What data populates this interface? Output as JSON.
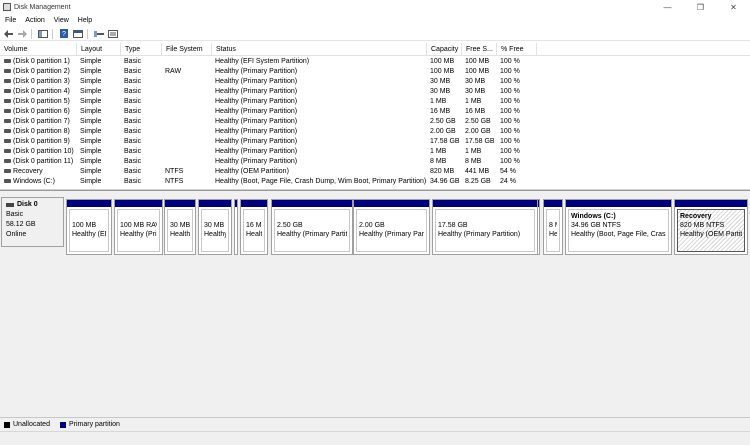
{
  "window": {
    "title": "Disk Management",
    "minimize": "—",
    "restore": "❐",
    "close": "✕"
  },
  "menu": [
    "File",
    "Action",
    "View",
    "Help"
  ],
  "columns": [
    "Volume",
    "Layout",
    "Type",
    "File System",
    "Status",
    "Capacity",
    "Free S...",
    "% Free"
  ],
  "volumes": [
    {
      "volume": "(Disk 0 partition 1)",
      "layout": "Simple",
      "type": "Basic",
      "fs": "",
      "status": "Healthy (EFI System Partition)",
      "capacity": "100 MB",
      "free": "100 MB",
      "pct": "100 %"
    },
    {
      "volume": "(Disk 0 partition 2)",
      "layout": "Simple",
      "type": "Basic",
      "fs": "RAW",
      "status": "Healthy (Primary Partition)",
      "capacity": "100 MB",
      "free": "100 MB",
      "pct": "100 %"
    },
    {
      "volume": "(Disk 0 partition 3)",
      "layout": "Simple",
      "type": "Basic",
      "fs": "",
      "status": "Healthy (Primary Partition)",
      "capacity": "30 MB",
      "free": "30 MB",
      "pct": "100 %"
    },
    {
      "volume": "(Disk 0 partition 4)",
      "layout": "Simple",
      "type": "Basic",
      "fs": "",
      "status": "Healthy (Primary Partition)",
      "capacity": "30 MB",
      "free": "30 MB",
      "pct": "100 %"
    },
    {
      "volume": "(Disk 0 partition 5)",
      "layout": "Simple",
      "type": "Basic",
      "fs": "",
      "status": "Healthy (Primary Partition)",
      "capacity": "1 MB",
      "free": "1 MB",
      "pct": "100 %"
    },
    {
      "volume": "(Disk 0 partition 6)",
      "layout": "Simple",
      "type": "Basic",
      "fs": "",
      "status": "Healthy (Primary Partition)",
      "capacity": "16 MB",
      "free": "16 MB",
      "pct": "100 %"
    },
    {
      "volume": "(Disk 0 partition 7)",
      "layout": "Simple",
      "type": "Basic",
      "fs": "",
      "status": "Healthy (Primary Partition)",
      "capacity": "2.50 GB",
      "free": "2.50 GB",
      "pct": "100 %"
    },
    {
      "volume": "(Disk 0 partition 8)",
      "layout": "Simple",
      "type": "Basic",
      "fs": "",
      "status": "Healthy (Primary Partition)",
      "capacity": "2.00 GB",
      "free": "2.00 GB",
      "pct": "100 %"
    },
    {
      "volume": "(Disk 0 partition 9)",
      "layout": "Simple",
      "type": "Basic",
      "fs": "",
      "status": "Healthy (Primary Partition)",
      "capacity": "17.58 GB",
      "free": "17.58 GB",
      "pct": "100 %"
    },
    {
      "volume": "(Disk 0 partition 10)",
      "layout": "Simple",
      "type": "Basic",
      "fs": "",
      "status": "Healthy (Primary Partition)",
      "capacity": "1 MB",
      "free": "1 MB",
      "pct": "100 %"
    },
    {
      "volume": "(Disk 0 partition 11)",
      "layout": "Simple",
      "type": "Basic",
      "fs": "",
      "status": "Healthy (Primary Partition)",
      "capacity": "8 MB",
      "free": "8 MB",
      "pct": "100 %"
    },
    {
      "volume": "Recovery",
      "layout": "Simple",
      "type": "Basic",
      "fs": "NTFS",
      "status": "Healthy (OEM Partition)",
      "capacity": "820 MB",
      "free": "441 MB",
      "pct": "54 %"
    },
    {
      "volume": "Windows (C:)",
      "layout": "Simple",
      "type": "Basic",
      "fs": "NTFS",
      "status": "Healthy (Boot, Page File, Crash Dump, Wim Boot, Primary Partition)",
      "capacity": "34.96 GB",
      "free": "8.25 GB",
      "pct": "24 %"
    }
  ],
  "disk": {
    "name": "Disk 0",
    "type": "Basic",
    "size": "58.12 GB",
    "state": "Online"
  },
  "partitions": [
    {
      "title": "",
      "l1": "100 MB",
      "l2": "Healthy (EFI"
    },
    {
      "title": "",
      "l1": "100 MB RAV",
      "l2": "Healthy (Prir"
    },
    {
      "title": "",
      "l1": "30 MB",
      "l2": "Healthy"
    },
    {
      "title": "",
      "l1": "30 MB",
      "l2": "Healthy"
    },
    {
      "title": "",
      "l1": "",
      "l2": ""
    },
    {
      "title": "",
      "l1": "16 MB",
      "l2": "Health"
    },
    {
      "title": "",
      "l1": "2.50 GB",
      "l2": "Healthy (Primary Partitio"
    },
    {
      "title": "",
      "l1": "2.00 GB",
      "l2": "Healthy (Primary Partitio"
    },
    {
      "title": "",
      "l1": "17.58 GB",
      "l2": "Healthy (Primary Partition)"
    },
    {
      "title": "",
      "l1": "",
      "l2": ""
    },
    {
      "title": "",
      "l1": "8 MI",
      "l2": "Heal"
    },
    {
      "title": "Windows  (C:)",
      "l1": "34.96 GB NTFS",
      "l2": "Healthy (Boot, Page File, Crash D"
    },
    {
      "title": "Recovery",
      "l1": "820 MB NTFS",
      "l2": "Healthy (OEM Partitio"
    }
  ],
  "legend": [
    {
      "label": "Unallocated",
      "color": "#000000"
    },
    {
      "label": "Primary partition",
      "color": "#00007f"
    }
  ]
}
